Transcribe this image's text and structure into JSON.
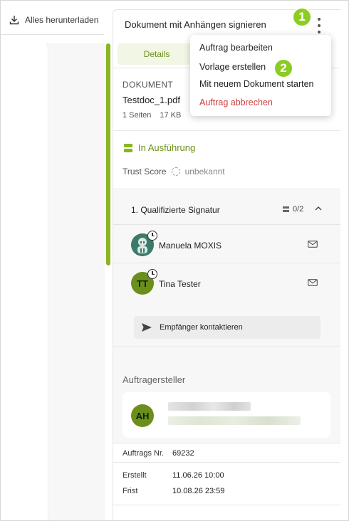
{
  "toolbar": {
    "download_label": "Alles herunterladen"
  },
  "panel": {
    "title": "Dokument mit Anhängen signieren",
    "tab_active": "Details"
  },
  "document": {
    "label": "DOKUMENT",
    "name": "Testdoc_1.pdf",
    "pages": "1 Seiten",
    "size": "17 KB"
  },
  "status": {
    "label": "In Ausführung",
    "trust_label": "Trust Score",
    "trust_value": "unbekannt"
  },
  "signature": {
    "title": "1. Qualifizierte Signatur",
    "count": "0/2",
    "signers": [
      {
        "name": "Manuela MOXIS",
        "avatar": ""
      },
      {
        "name": "Tina Tester",
        "avatar": "TT"
      }
    ],
    "contact_label": "Empfänger kontaktieren"
  },
  "creator": {
    "label": "Auftragersteller",
    "initials": "AH"
  },
  "order": {
    "label": "Auftrags Nr.",
    "value": "69232"
  },
  "dates": {
    "created_label": "Erstellt",
    "created_value": "11.06.26 10:00",
    "due_label": "Frist",
    "due_value": "10.08.26 23:59"
  },
  "menu": {
    "items": [
      "Auftrag bearbeiten",
      "Vorlage erstellen",
      "Mit neuem Dokument starten",
      "Auftrag abbrechen"
    ]
  },
  "badges": {
    "first": "1",
    "second": "2"
  },
  "colors": {
    "accent": "#8ab520",
    "status_text": "#6c8f1d",
    "danger": "#d23a3a",
    "badge": "#8ccc23"
  },
  "icons": [
    "download-icon",
    "kebab-menu-icon",
    "status-icon",
    "trust-spinner-icon",
    "signature-count-icon",
    "chevron-up-icon",
    "clock-icon",
    "mail-icon",
    "send-icon"
  ]
}
